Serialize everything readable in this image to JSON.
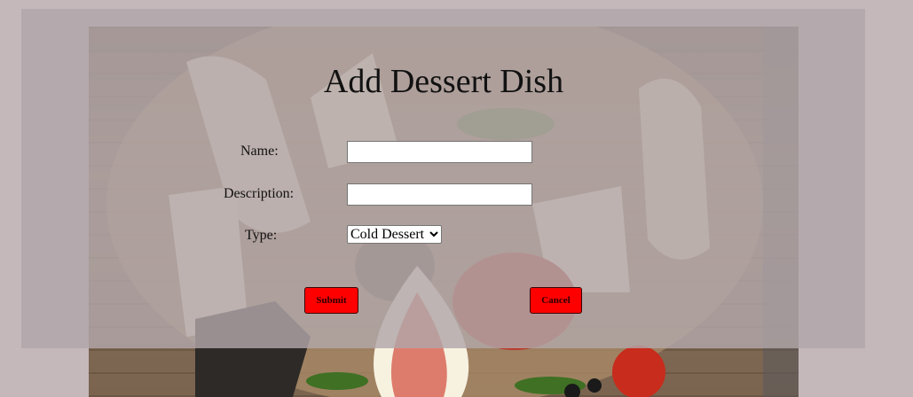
{
  "form": {
    "title": "Add Dessert Dish",
    "name_label": "Name:",
    "name_value": "",
    "description_label": "Description:",
    "description_value": "",
    "type_label": "Type:",
    "type_selected": "Cold Dessert",
    "submit_label": "Submit",
    "cancel_label": "Cancel"
  },
  "colors": {
    "page_background": "#c4b8ba",
    "overlay": "#b1a6a8",
    "button_red": "#ff0000"
  }
}
